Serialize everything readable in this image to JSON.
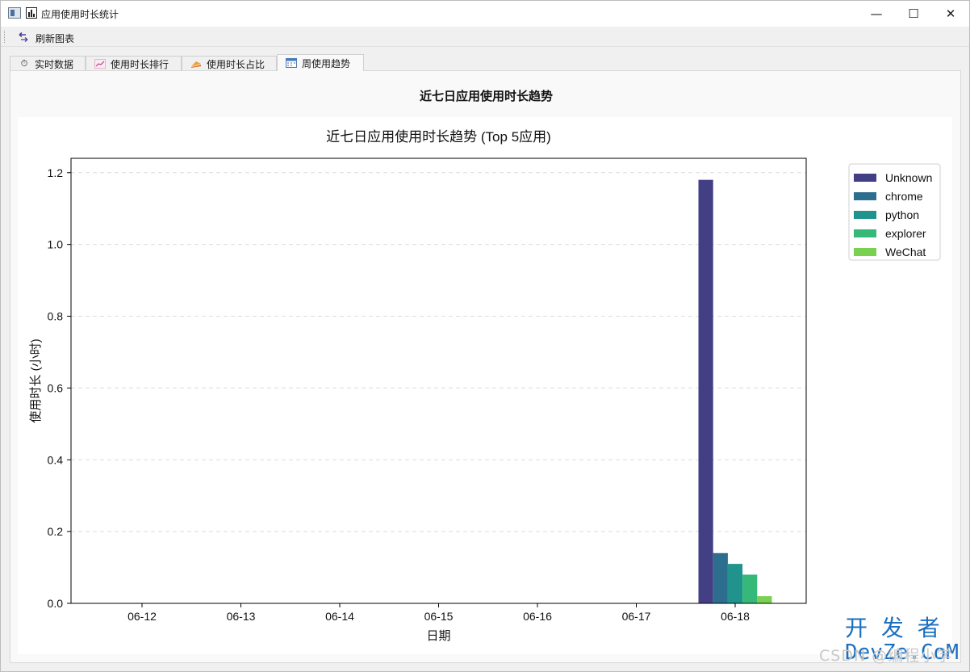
{
  "window": {
    "title": "应用使用时长统计",
    "minimize_glyph": "—",
    "maximize_glyph": "☐",
    "close_glyph": "✕"
  },
  "toolbar": {
    "refresh_label": "刷新图表",
    "refresh_icon": "refresh-icon"
  },
  "tabs": [
    {
      "label": "实时数据",
      "icon": "stopwatch-icon",
      "active": false
    },
    {
      "label": "使用时长排行",
      "icon": "line-chart-icon",
      "active": false
    },
    {
      "label": "使用时长占比",
      "icon": "pie-chart-icon",
      "active": false
    },
    {
      "label": "周使用趋势",
      "icon": "calendar-icon",
      "active": true
    }
  ],
  "panel": {
    "title": "近七日应用使用时长趋势"
  },
  "chart_data": {
    "type": "bar",
    "title": "近七日应用使用时长趋势 (Top 5应用)",
    "xlabel": "日期",
    "ylabel": "使用时长 (小时)",
    "categories": [
      "06-12",
      "06-13",
      "06-14",
      "06-15",
      "06-16",
      "06-17",
      "06-18"
    ],
    "ylim": [
      0,
      1.24
    ],
    "yticks": [
      "0.0",
      "0.2",
      "0.4",
      "0.6",
      "0.8",
      "1.0",
      "1.2"
    ],
    "grid": "horizontal-dashed",
    "legend_position": "upper-right-outside",
    "series": [
      {
        "name": "Unknown",
        "color": "#433f84",
        "values": [
          0,
          0,
          0,
          0,
          0,
          0,
          1.18
        ]
      },
      {
        "name": "chrome",
        "color": "#2d6e8e",
        "values": [
          0,
          0,
          0,
          0,
          0,
          0,
          0.14
        ]
      },
      {
        "name": "python",
        "color": "#20938c",
        "values": [
          0,
          0,
          0,
          0,
          0,
          0,
          0.11
        ]
      },
      {
        "name": "explorer",
        "color": "#36b878",
        "values": [
          0,
          0,
          0,
          0,
          0,
          0,
          0.08
        ]
      },
      {
        "name": "WeChat",
        "color": "#7ad151",
        "values": [
          0,
          0,
          0,
          0,
          0,
          0,
          0.02
        ]
      }
    ]
  },
  "watermark": {
    "text": "CSDN @编程小学",
    "brand_top": "开 发 者",
    "brand_bottom": "DevZe.CoM"
  }
}
